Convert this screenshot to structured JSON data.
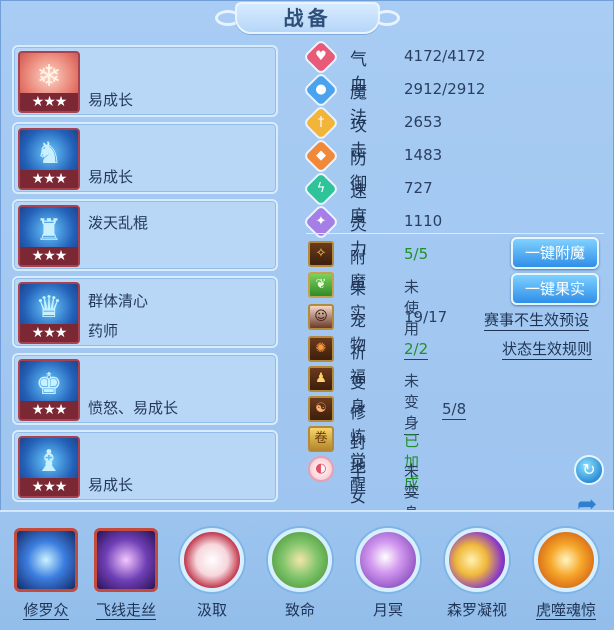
{
  "title": "战备",
  "skills": [
    {
      "icon": "popsicle-icon",
      "stars": "★★★",
      "lines": [
        "易成长"
      ]
    },
    {
      "icon": "warrior-icon",
      "stars": "★★★",
      "lines": [
        "易成长"
      ]
    },
    {
      "icon": "warrior-icon",
      "stars": "★★★",
      "lines": [
        "泼天乱棍"
      ]
    },
    {
      "icon": "mage-icon",
      "stars": "★★★",
      "lines": [
        "群体清心",
        "药师"
      ]
    },
    {
      "icon": "helmet-icon",
      "stars": "★★★",
      "lines": [
        "愤怒、易成长"
      ]
    },
    {
      "icon": "armor-icon",
      "stars": "★★★",
      "lines": [
        "易成长"
      ]
    }
  ],
  "attributes": [
    {
      "label": "气血",
      "value": "4172/4172",
      "color": "#e85a78",
      "icon": "heart-icon"
    },
    {
      "label": "魔法",
      "value": "2912/2912",
      "color": "#4aa3ec",
      "icon": "drop-icon"
    },
    {
      "label": "攻击",
      "value": "2653",
      "color": "#f2b53a",
      "icon": "sword-icon"
    },
    {
      "label": "防御",
      "value": "1483",
      "color": "#f08a3a",
      "icon": "shield-icon"
    },
    {
      "label": "速度",
      "value": "727",
      "color": "#2fc39a",
      "icon": "bolt-icon"
    },
    {
      "label": "灵力",
      "value": "1110",
      "color": "#a57ee6",
      "icon": "spirit-icon"
    }
  ],
  "equipment": [
    {
      "label": "附魔",
      "value": "5/5",
      "style": "green"
    },
    {
      "label": "果实",
      "value": "未使用",
      "style": ""
    },
    {
      "label": "宠物",
      "value": "19/17",
      "style": ""
    },
    {
      "label": "祈福",
      "value": "2/2",
      "style": "green underline"
    },
    {
      "label": "变身",
      "value": "未变身",
      "style": "underline"
    },
    {
      "label": "修炼觉醒",
      "value": "5/8",
      "style": "underline"
    },
    {
      "label": "封地",
      "value": "已加成",
      "style": "green underline"
    },
    {
      "label": "子女",
      "value": "未变身",
      "style": "underline"
    }
  ],
  "buttons": {
    "enchant": "一键附魔",
    "fruit": "一键果实",
    "preset": "赛事不生效预设",
    "rules": "状态生效规则"
  },
  "bottom_skills": [
    {
      "name": "修罗众",
      "type": "square",
      "icon": "star-burst-icon"
    },
    {
      "name": "飞线走丝",
      "type": "square",
      "icon": "silk-icon"
    },
    {
      "name": "汲取",
      "type": "circle",
      "icon": "absorb-icon"
    },
    {
      "name": "致命",
      "type": "circle",
      "icon": "vine-icon"
    },
    {
      "name": "月冥",
      "type": "circle",
      "icon": "moon-orb-icon"
    },
    {
      "name": "森罗凝视",
      "type": "circle",
      "icon": "crescent-icon"
    },
    {
      "name": "虎噬魂惊",
      "type": "circle",
      "icon": "tiger-icon"
    }
  ]
}
